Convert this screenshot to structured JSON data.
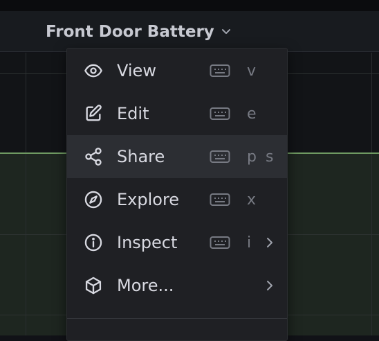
{
  "panel": {
    "title": "Front Door Battery"
  },
  "menu": {
    "items": [
      {
        "label": "View",
        "icon": "eye-icon",
        "shortcut": "v",
        "keyboard_icon": true,
        "submenu": false,
        "highlighted": false
      },
      {
        "label": "Edit",
        "icon": "edit-icon",
        "shortcut": "e",
        "keyboard_icon": true,
        "submenu": false,
        "highlighted": false
      },
      {
        "label": "Share",
        "icon": "share-icon",
        "shortcut": "p s",
        "keyboard_icon": true,
        "submenu": false,
        "highlighted": true
      },
      {
        "label": "Explore",
        "icon": "compass-icon",
        "shortcut": "x",
        "keyboard_icon": true,
        "submenu": false,
        "highlighted": false
      },
      {
        "label": "Inspect",
        "icon": "info-circle-icon",
        "shortcut": "i",
        "keyboard_icon": true,
        "submenu": true,
        "highlighted": false
      },
      {
        "label": "More...",
        "icon": "cube-icon",
        "shortcut": "",
        "keyboard_icon": false,
        "submenu": true,
        "highlighted": false
      }
    ]
  },
  "colors": {
    "menu_background": "#1f2024",
    "highlight_background": "#2c2e33",
    "series_line": "#6f9a62"
  }
}
